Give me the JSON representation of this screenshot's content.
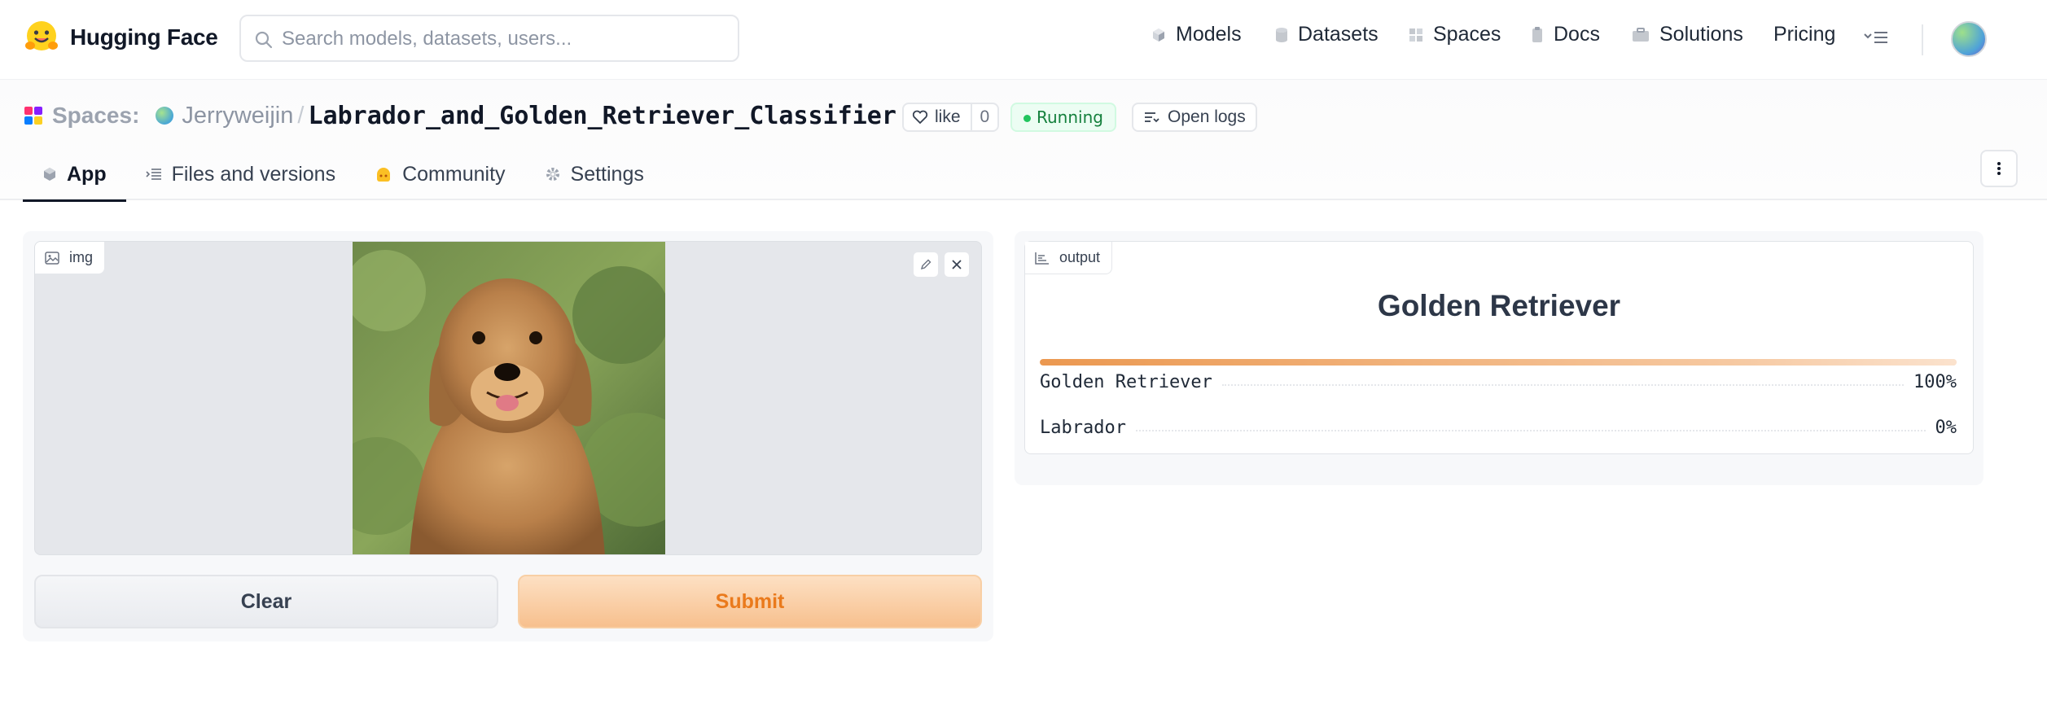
{
  "topbar": {
    "brand": "Hugging Face",
    "search_placeholder": "Search models, datasets, users...",
    "nav": [
      {
        "label": "Models",
        "icon": "cube-icon"
      },
      {
        "label": "Datasets",
        "icon": "database-icon"
      },
      {
        "label": "Spaces",
        "icon": "grid-icon"
      },
      {
        "label": "Docs",
        "icon": "document-icon"
      },
      {
        "label": "Solutions",
        "icon": "briefcase-icon"
      },
      {
        "label": "Pricing",
        "icon": ""
      }
    ]
  },
  "space": {
    "spaces_label": "Spaces:",
    "owner": "Jerryweijin",
    "separator": "/",
    "repo": "Labrador_and_Golden_Retriever_Classifier",
    "like_label": "like",
    "like_count": "0",
    "status": "Running",
    "logs_label": "Open logs",
    "tabs": [
      {
        "label": "App",
        "icon": "cube-icon",
        "active": true
      },
      {
        "label": "Files and versions",
        "icon": "files-icon",
        "active": false
      },
      {
        "label": "Community",
        "icon": "community-icon",
        "active": false
      },
      {
        "label": "Settings",
        "icon": "gear-icon",
        "active": false
      }
    ]
  },
  "app": {
    "input_label": "img",
    "clear_label": "Clear",
    "submit_label": "Submit",
    "output_label": "output",
    "prediction": "Golden Retriever",
    "top_confidence": 1.0,
    "confidences": [
      {
        "label": "Golden Retriever",
        "value": "100%"
      },
      {
        "label": "Labrador",
        "value": "0%"
      }
    ]
  },
  "colors": {
    "accent": "#ea7a1c",
    "running": "#22c55e"
  }
}
